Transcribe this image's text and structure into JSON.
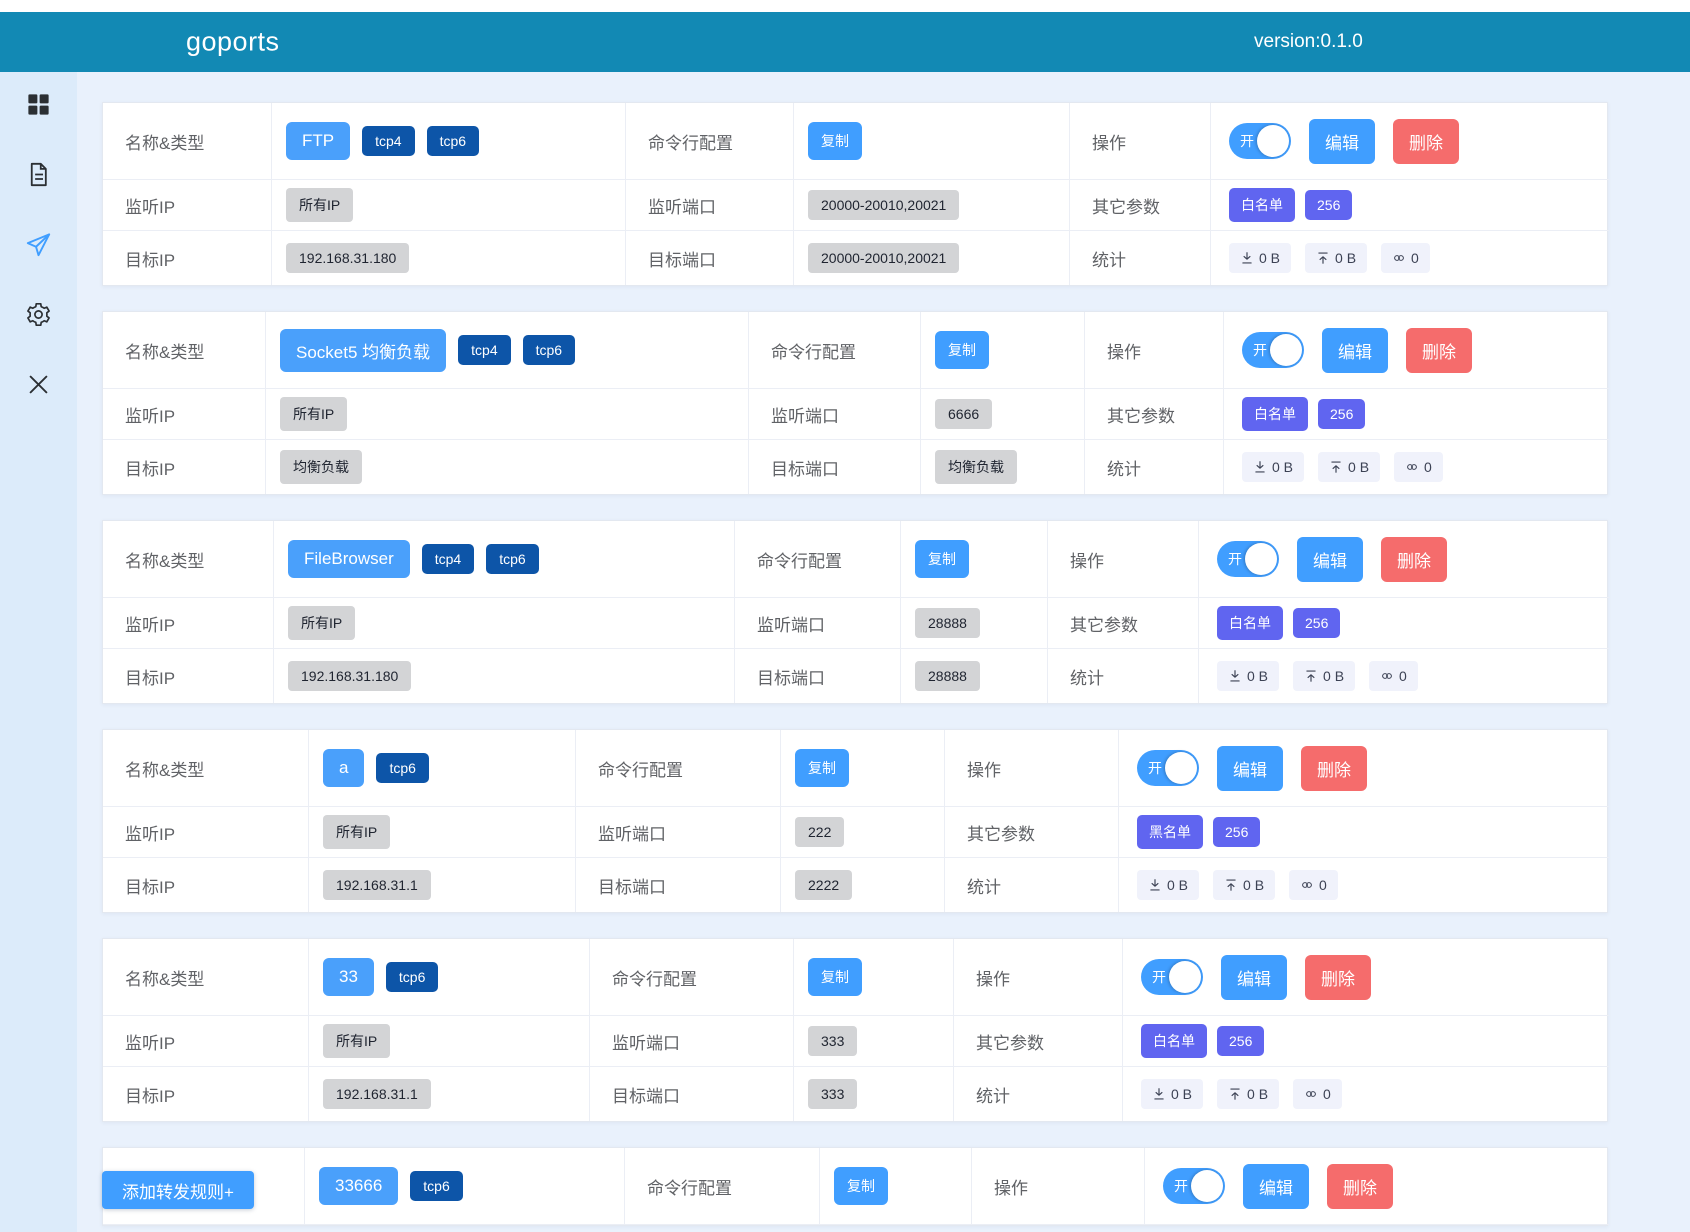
{
  "header": {
    "title": "goports",
    "version": "version:0.1.0"
  },
  "sidebar": {
    "items": [
      {
        "icon": "grid-menu-icon"
      },
      {
        "icon": "document-icon"
      },
      {
        "icon": "send-icon",
        "active": true
      },
      {
        "icon": "settings-gear-icon"
      },
      {
        "icon": "close-icon"
      }
    ]
  },
  "labels": {
    "name_type": "名称&类型",
    "cmd_config": "命令行配置",
    "actions": "操作",
    "listen_ip": "监听IP",
    "listen_port": "监听端口",
    "other_params": "其它参数",
    "target_ip": "目标IP",
    "target_port": "目标端口",
    "stats": "统计",
    "copy": "复制",
    "edit": "编辑",
    "delete": "删除",
    "toggle_on": "开"
  },
  "add_rule": {
    "label": "添加转发规则+"
  },
  "colors": {
    "header_bg": "#1289b4",
    "page_bg": "#e9f1fc",
    "sidebar_bg": "#dcebfa",
    "primary_blue": "#409eff",
    "danger_red": "#f56c6c",
    "name_badge_blue": "#4aa0fb",
    "protocol_navy": "#0d55a8",
    "tag_purple": "#6065f0",
    "tag_gray": "#d3d4d6",
    "chip_bg": "#f0f2fb"
  },
  "cards": [
    {
      "name": "FTP",
      "protocols": [
        "tcp4",
        "tcp6"
      ],
      "toggle_on": true,
      "listen_ip": "所有IP",
      "listen_port": "20000-20010,20021",
      "params": [
        "白名单",
        "256"
      ],
      "target_ip": "192.168.31.180",
      "target_port": "20000-20010,20021",
      "stats": {
        "down": "0 B",
        "up": "0 B",
        "connections": "0"
      }
    },
    {
      "name": "Socket5 均衡负载",
      "protocols": [
        "tcp4",
        "tcp6"
      ],
      "toggle_on": true,
      "listen_ip": "所有IP",
      "listen_port": "6666",
      "params": [
        "白名单",
        "256"
      ],
      "target_ip": "均衡负载",
      "target_port": "均衡负载",
      "stats": {
        "down": "0 B",
        "up": "0 B",
        "connections": "0"
      }
    },
    {
      "name": "FileBrowser",
      "protocols": [
        "tcp4",
        "tcp6"
      ],
      "toggle_on": true,
      "listen_ip": "所有IP",
      "listen_port": "28888",
      "params": [
        "白名单",
        "256"
      ],
      "target_ip": "192.168.31.180",
      "target_port": "28888",
      "stats": {
        "down": "0 B",
        "up": "0 B",
        "connections": "0"
      }
    },
    {
      "name": "a",
      "protocols": [
        "tcp6"
      ],
      "toggle_on": true,
      "listen_ip": "所有IP",
      "listen_port": "222",
      "params": [
        "黑名单",
        "256"
      ],
      "target_ip": "192.168.31.1",
      "target_port": "2222",
      "stats": {
        "down": "0 B",
        "up": "0 B",
        "connections": "0"
      }
    },
    {
      "name": "33",
      "protocols": [
        "tcp6"
      ],
      "toggle_on": true,
      "listen_ip": "所有IP",
      "listen_port": "333",
      "params": [
        "白名单",
        "256"
      ],
      "target_ip": "192.168.31.1",
      "target_port": "333",
      "stats": {
        "down": "0 B",
        "up": "0 B",
        "connections": "0"
      }
    },
    {
      "name": "33666",
      "protocols": [
        "tcp6"
      ],
      "toggle_on": true,
      "partial": true
    }
  ]
}
